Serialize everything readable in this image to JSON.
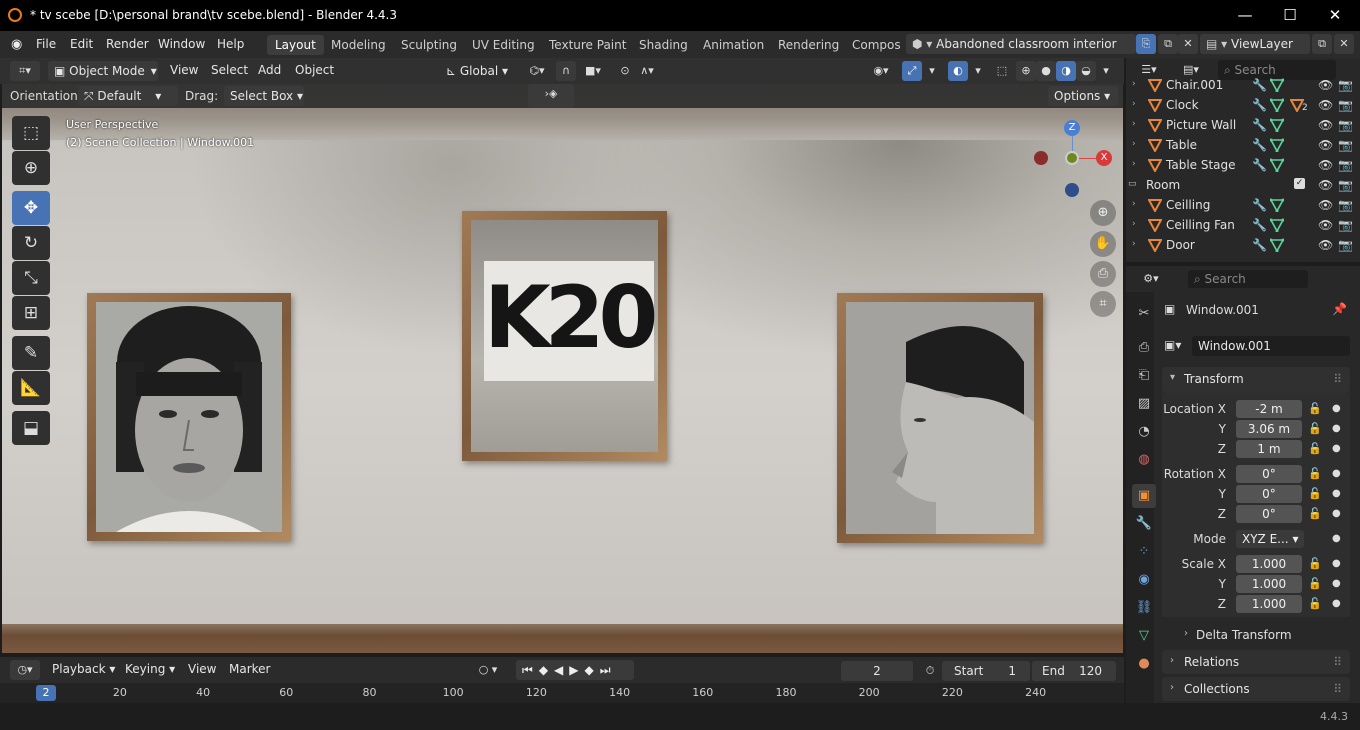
{
  "window": {
    "title": "* tv scebe [D:\\personal brand\\tv scebe.blend] - Blender 4.4.3",
    "minimize": "—",
    "maximize": "☐",
    "close": "✕"
  },
  "menus": [
    "File",
    "Edit",
    "Render",
    "Window",
    "Help"
  ],
  "workspaces": [
    "Layout",
    "Modeling",
    "Sculpting",
    "UV Editing",
    "Texture Paint",
    "Shading",
    "Animation",
    "Rendering",
    "Compos"
  ],
  "scene_name": "Abandoned classroom interior",
  "view_layer": "ViewLayer",
  "viewport_header": {
    "mode": "Object Mode",
    "menus": [
      "View",
      "Select",
      "Add",
      "Object"
    ],
    "transform_orientation": "Global"
  },
  "tool_settings": {
    "orientation_label": "Orientation:",
    "orientation_value": "Default",
    "drag_label": "Drag:",
    "drag_value": "Select Box",
    "options": "Options"
  },
  "viewport": {
    "perspective": "User Perspective",
    "collection_info": "(2) Scene Collection | Window.001",
    "gizmo_x": "X",
    "gizmo_z": "Z"
  },
  "poster_text": "K20",
  "timeline": {
    "menus": [
      "Playback",
      "Keying",
      "View",
      "Marker"
    ],
    "current_frame": "2",
    "start_label": "Start",
    "start_value": "1",
    "end_label": "End",
    "end_value": "120",
    "ticks": [
      "20",
      "40",
      "60",
      "80",
      "100",
      "120",
      "140",
      "160",
      "180",
      "200",
      "220",
      "240"
    ],
    "playhead": "2"
  },
  "outliner": {
    "search_placeholder": "Search",
    "rows": [
      {
        "name": "Chair.001",
        "type": "object"
      },
      {
        "name": "Clock",
        "type": "object",
        "badge": "2"
      },
      {
        "name": "Picture Wall",
        "type": "object"
      },
      {
        "name": "Table",
        "type": "object"
      },
      {
        "name": "Table Stage",
        "type": "object"
      },
      {
        "name": "Room",
        "type": "collection"
      },
      {
        "name": "Ceilling",
        "type": "object"
      },
      {
        "name": "Ceilling Fan",
        "type": "object"
      },
      {
        "name": "Door",
        "type": "object"
      }
    ]
  },
  "properties": {
    "search_placeholder": "Search",
    "object_title": "Window.001",
    "object_name": "Window.001",
    "transform_header": "Transform",
    "location": {
      "label": "Location X",
      "x": "-2 m",
      "y": "3.06 m",
      "z": "1 m"
    },
    "rotation": {
      "label": "Rotation X",
      "x": "0°",
      "y": "0°",
      "z": "0°"
    },
    "mode_label": "Mode",
    "mode_value": "XYZ E...",
    "scale": {
      "label": "Scale X",
      "x": "1.000",
      "y": "1.000",
      "z": "1.000"
    },
    "axis_y": "Y",
    "axis_z": "Z",
    "delta_transform": "Delta Transform",
    "relations": "Relations",
    "collections": "Collections"
  },
  "status": {
    "version": "4.4.3"
  },
  "colors": {
    "accent": "#4772b3",
    "mesh_icon": "#e6863a",
    "modifier_icon": "#6fa3e0",
    "data_icon": "#5bd49a"
  }
}
